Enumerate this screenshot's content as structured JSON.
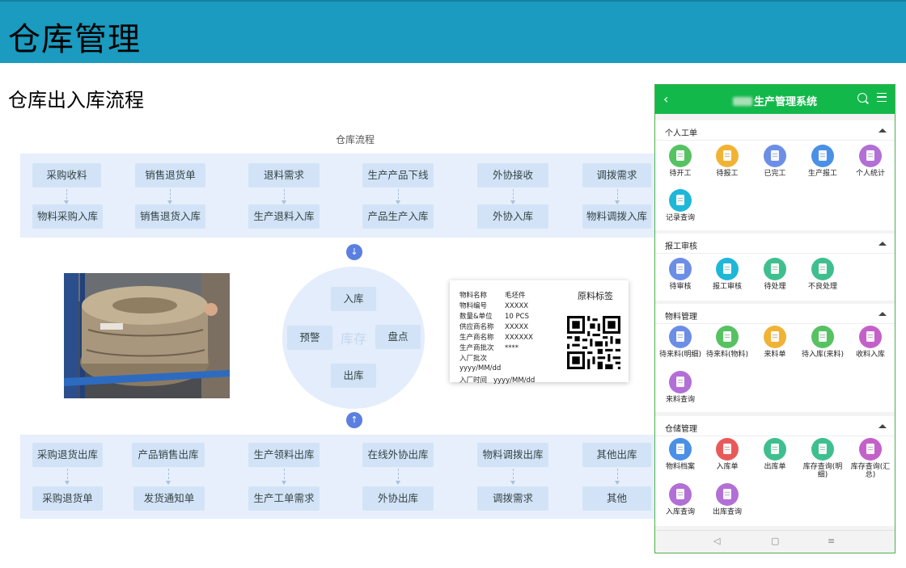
{
  "slide": {
    "title": "仓库管理",
    "subtitle": "仓库出入库流程"
  },
  "flow": {
    "caption": "仓库流程",
    "top_row": [
      {
        "upper": "采购收料",
        "lower": "物料采购入库"
      },
      {
        "upper": "销售退货单",
        "lower": "销售退货入库"
      },
      {
        "upper": "退料需求",
        "lower": "生产退料入库"
      },
      {
        "upper": "生产产品下线",
        "lower": "产品生产入库"
      },
      {
        "upper": "外协接收",
        "lower": "外协入库"
      },
      {
        "upper": "调拨需求",
        "lower": "物料调拨入库"
      }
    ],
    "bottom_row": [
      {
        "upper": "采购退货出库",
        "lower": "采购退货单"
      },
      {
        "upper": "产品销售出库",
        "lower": "发货通知单"
      },
      {
        "upper": "生产领料出库",
        "lower": "生产工单需求"
      },
      {
        "upper": "在线外协出库",
        "lower": "外协出库"
      },
      {
        "upper": "物料调拨出库",
        "lower": "调拨需求"
      },
      {
        "upper": "其他出库",
        "lower": "其他"
      }
    ],
    "circle": {
      "center": "库存",
      "top": "入库",
      "left": "预警",
      "right": "盘点",
      "bottom": "出库"
    },
    "arrow_down_icon": "arrow-down-icon",
    "arrow_up_icon": "arrow-up-icon"
  },
  "material_label": {
    "title": "原料标签",
    "rows": [
      {
        "k": "物料名称",
        "v": "毛坯件"
      },
      {
        "k": "物料编号",
        "v": "XXXXX"
      },
      {
        "k": "数量&单位",
        "v": "10 PCS"
      },
      {
        "k": "供应商名称",
        "v": "XXXXX"
      },
      {
        "k": "生产商名称",
        "v": "XXXXXX"
      },
      {
        "k": "生产商批次",
        "v": "****"
      },
      {
        "k": "入厂批次",
        "v": ""
      },
      {
        "k": "yyyy/MM/dd",
        "v": ""
      },
      {
        "k": "入厂时间",
        "v": "yyyy/MM/dd"
      }
    ]
  },
  "phone": {
    "title": "生产管理系统",
    "colors": {
      "header": "#13b84b"
    },
    "sections": [
      {
        "name": "个人工单",
        "apps": [
          {
            "label": "待开工",
            "color": "#56c262"
          },
          {
            "label": "待报工",
            "color": "#f1b335"
          },
          {
            "label": "已完工",
            "color": "#6c8ee6"
          },
          {
            "label": "生产报工",
            "color": "#4a90e6"
          },
          {
            "label": "个人统计",
            "color": "#b26fd6"
          },
          {
            "label": "记录查询",
            "color": "#1fb7d8"
          }
        ]
      },
      {
        "name": "报工审核",
        "apps": [
          {
            "label": "待审核",
            "color": "#6c8ee6"
          },
          {
            "label": "报工审核",
            "color": "#1fb7d8"
          },
          {
            "label": "待处理",
            "color": "#3fbf8f"
          },
          {
            "label": "不良处理",
            "color": "#3fbf8f"
          }
        ]
      },
      {
        "name": "物料管理",
        "apps": [
          {
            "label": "待来料(明细)",
            "color": "#6c8ee6"
          },
          {
            "label": "待来料(物料)",
            "color": "#56c262"
          },
          {
            "label": "来料单",
            "color": "#f1b335"
          },
          {
            "label": "待入库(来料)",
            "color": "#56c262"
          },
          {
            "label": "收料入库",
            "color": "#c461c9"
          },
          {
            "label": "来料查询",
            "color": "#b26fd6"
          }
        ]
      },
      {
        "name": "仓储管理",
        "apps": [
          {
            "label": "物料档案",
            "color": "#4a90e6"
          },
          {
            "label": "入库单",
            "color": "#e85a5a"
          },
          {
            "label": "出库单",
            "color": "#3fbf8f"
          },
          {
            "label": "库存查询(明细)",
            "color": "#3fbf8f"
          },
          {
            "label": "库存查询(汇总)",
            "color": "#c461c9"
          },
          {
            "label": "入库查询",
            "color": "#b26fd6"
          },
          {
            "label": "出库查询",
            "color": "#b26fd6"
          }
        ]
      }
    ],
    "navbar": {
      "back": "◁",
      "home": "▢",
      "menu": "≡"
    }
  }
}
